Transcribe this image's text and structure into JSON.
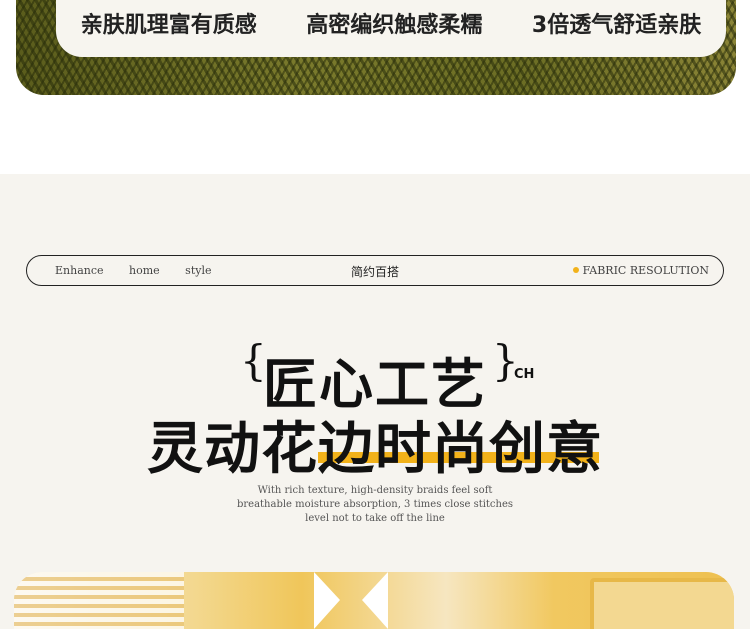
{
  "features": [
    "亲肤肌理富有质感",
    "高密编织触感柔糯",
    "3倍透气舒适亲肤"
  ],
  "nav": {
    "left_words": [
      "Enhance",
      "home",
      "style"
    ],
    "center": "简约百搭",
    "right": "FABRIC RESOLUTION"
  },
  "headline": {
    "line1": "匠心工艺",
    "brace_open": "{",
    "brace_close": "}",
    "tag": "CH",
    "line2": "灵动花边时尚创意"
  },
  "description": [
    "With rich texture, high-density braids feel soft",
    "breathable moisture absorption, 3 times close stitches",
    "level not to take off the line"
  ],
  "colors": {
    "accent": "#f2b21a",
    "section_bg": "#f6f4ef",
    "fabric": "#6b6d24"
  }
}
